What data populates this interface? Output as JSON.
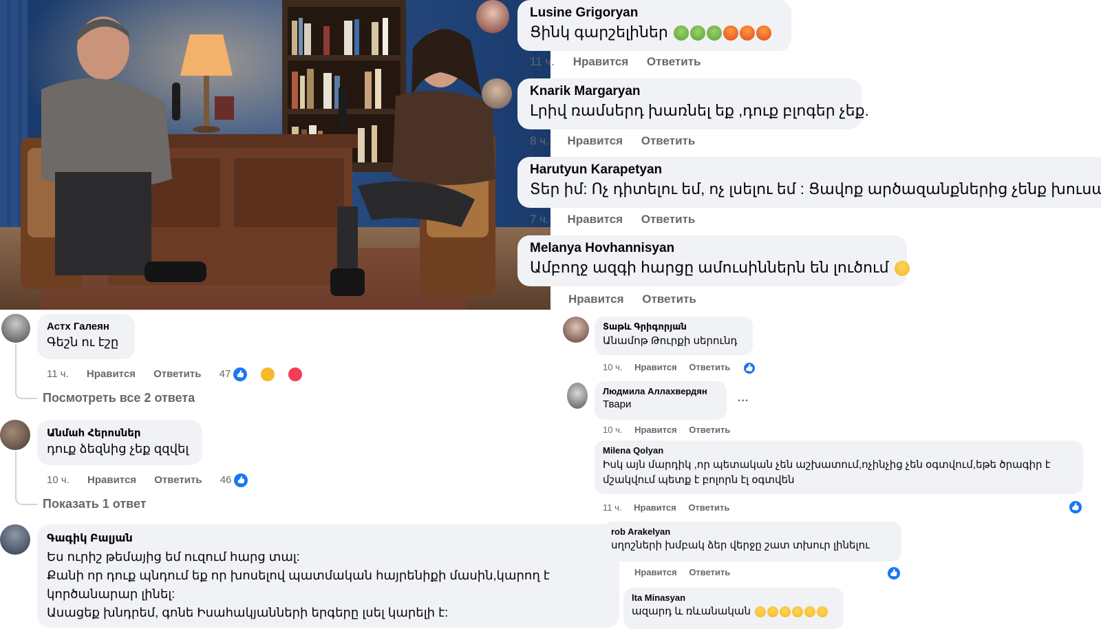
{
  "top_right": [
    {
      "author": "Lusine Grigoryan",
      "text": "Ցինկ գարշելիներ",
      "emoji_suffix": [
        "sick-face",
        "sick-face",
        "sick-face",
        "angry-face",
        "angry-face",
        "angry-face"
      ],
      "time": "11 ч.",
      "like": "Нравится",
      "reply": "Ответить"
    },
    {
      "author": "Knarik Margaryan",
      "text": "Լրիվ ռամսերդ խառնել եք ,դուք բլոգեր չեք.",
      "time": "8 ч.",
      "like": "Нравится",
      "reply": "Ответить"
    },
    {
      "author": "Harutyun Karapetyan",
      "text": "Տեր իմ: Ոչ դիտելու եմ, ոչ լսելու եմ : Ցավոք արծազանքներից չենք խուսափի",
      "time": "7 ч.",
      "like": "Нравится",
      "reply": "Ответить"
    },
    {
      "author": "Melanya Hovhannisyan",
      "text": "Ամբողջ ազգի հարցը ամուսիններն են լուծում",
      "emoji_suffix": [
        "crying-face"
      ],
      "like": "Нравится",
      "reply": "Ответить"
    }
  ],
  "left": [
    {
      "author": "Астх Галеян",
      "text": "Գեշն ու էշը",
      "time": "11 ч.",
      "like": "Нравится",
      "reply": "Ответить",
      "reaction_count": "47",
      "reactions": [
        "like",
        "haha",
        "love"
      ],
      "more": "Посмотреть все 2 ответа"
    },
    {
      "author": "Անմահ Հերոսներ",
      "text": "դուք ձեզնից չեք զզվել",
      "time": "10 ч.",
      "like": "Нравится",
      "reply": "Ответить",
      "reaction_count": "46",
      "reactions": [
        "like"
      ],
      "more": "Показать 1 ответ"
    },
    {
      "author": "Գագիկ Բալյան",
      "lines": [
        "Ես ուրիշ թեմայից եմ ուզում հարց տալ:",
        "Քանի որ դուք պնդում եք որ խոսելով պատմական հայրենիքի մասին,կարող է",
        "կործանարար լինել:",
        "Ասացեք խնդրեմ, գոնե Իսահակյանների երգերը լսել կարելի է:"
      ]
    }
  ],
  "right_small": [
    {
      "author": "Տաթև Գրիգորյան",
      "text": "Անամոթ Թուրքի սերունդ",
      "time": "10 ч.",
      "like": "Нравится",
      "reply": "Ответить",
      "reactions": [
        "like"
      ]
    },
    {
      "author": "Людмила Аллахвердян",
      "text": "Твари",
      "time": "10 ч.",
      "like": "Нравится",
      "reply": "Ответить",
      "menu": "..."
    },
    {
      "author": "Milena Qolyan",
      "lines": [
        "Իսկ այն մարդիկ ,որ պետական չեն աշխատում,ոչինչից չեն օգտվում,եթե ծրագիր է",
        "մշակվում պետք է բոլորն էլ օգտվեն"
      ],
      "time": "11 ч.",
      "like": "Нравится",
      "reply": "Ответить",
      "reactions": [
        "like"
      ]
    },
    {
      "author": "rob Arakelyan",
      "text": "սղոշների խմբակ ձեր վերջը շատ տխուր լինելու",
      "like": "Нравится",
      "reply": "Ответить",
      "reactions": [
        "like"
      ]
    },
    {
      "author": "lta Minasyan",
      "text": "ազարդ և ռևանական",
      "emoji_suffix": [
        "hands",
        "hands",
        "hands",
        "crying-face",
        "crying-face",
        "crying-face"
      ]
    }
  ],
  "colors": {
    "bubble": "#f0f2f5",
    "meta": "#65676b",
    "like": "#1877f2",
    "haha": "#f7b928",
    "love": "#f33e58",
    "wall": "#1f3f70"
  }
}
